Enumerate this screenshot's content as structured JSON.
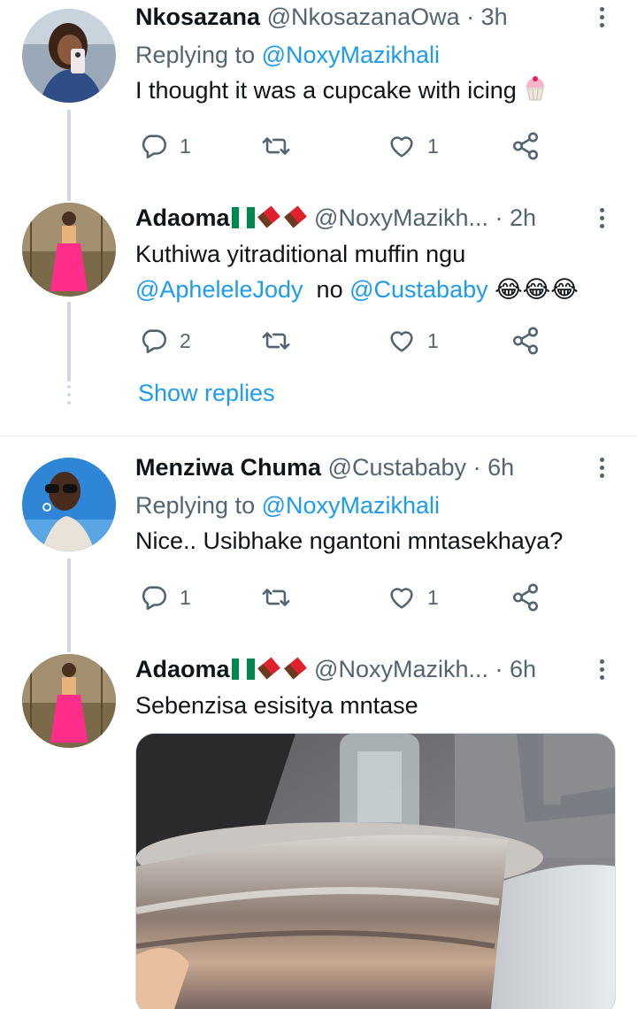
{
  "replies": [
    {
      "name": "Nkosazana",
      "handle": "@NkosazanaOwa",
      "sep": "·",
      "time": "3h",
      "replying_prefix": "Replying to ",
      "replying_handle": "@NoxyMazikhali",
      "text": "I thought it was a cupcake with icing",
      "counts": {
        "replies": "1",
        "likes": "1"
      }
    },
    {
      "name": "Adaoma",
      "handle": "@NoxyMazikh...",
      "sep": "·",
      "time": "2h",
      "text_line1": "Kuthiwa yitraditional muffin ngu",
      "mention1": "@ApheleleJody",
      "mid": "no",
      "mention2": "@Custababy",
      "emoji": "😂😂😂",
      "counts": {
        "replies": "2",
        "likes": "1"
      },
      "show_replies": "Show replies"
    },
    {
      "name": "Menziwa Chuma",
      "handle": "@Custababy",
      "sep": "·",
      "time": "6h",
      "replying_prefix": "Replying to ",
      "replying_handle": "@NoxyMazikhali",
      "text": "Nice.. Usibhake ngantoni mntasekhaya?",
      "counts": {
        "replies": "1",
        "likes": "1"
      }
    },
    {
      "name": "Adaoma",
      "handle": "@NoxyMazikh...",
      "sep": "·",
      "time": "6h",
      "text": "Sebenzisa esisitya mntase"
    }
  ],
  "icons": {
    "reply": "reply-icon",
    "retweet": "retweet-icon",
    "like": "like-icon",
    "share": "share-icon",
    "more": "more-icon"
  },
  "colors": {
    "link": "#1d9bf0",
    "secondary": "#536471",
    "primary": "#0f1419",
    "thread_line": "#cfd9de"
  }
}
